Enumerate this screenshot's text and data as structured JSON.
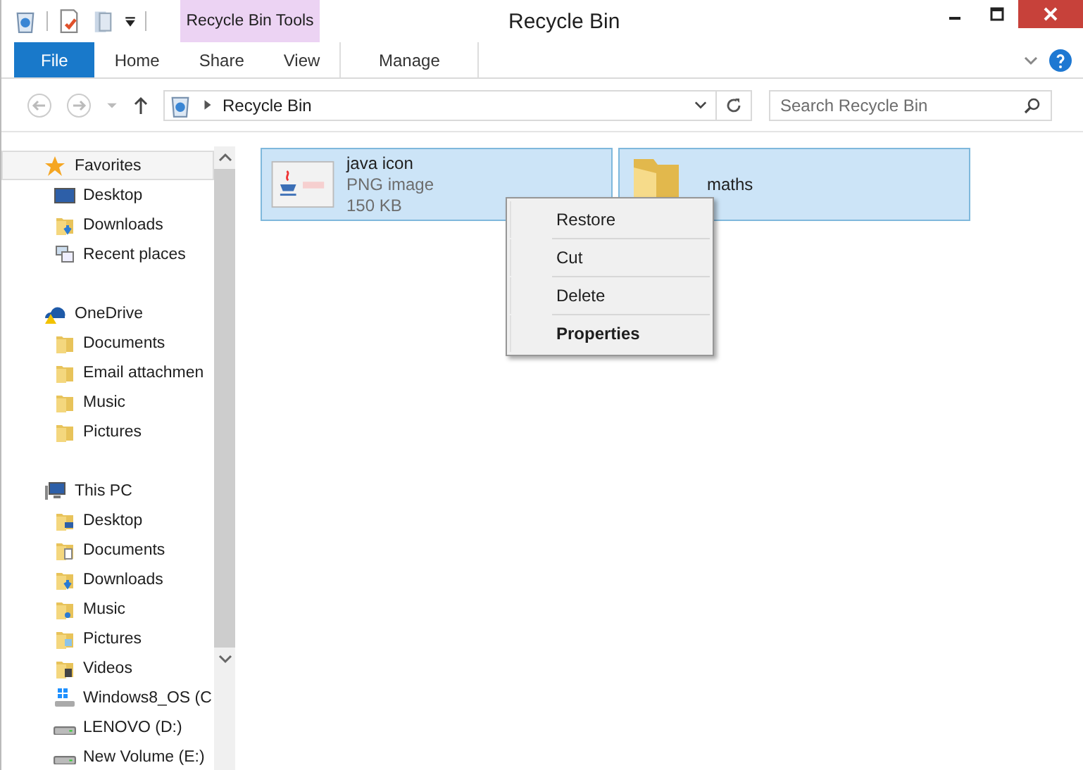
{
  "window": {
    "title": "Recycle Bin"
  },
  "contextual_tab_group": "Recycle Bin Tools",
  "ribbon_tabs": [
    {
      "label": "File",
      "kind": "file",
      "selected": false
    },
    {
      "label": "Home",
      "kind": "tab",
      "selected": false
    },
    {
      "label": "Share",
      "kind": "tab",
      "selected": false
    },
    {
      "label": "View",
      "kind": "tab",
      "selected": false
    },
    {
      "label": "Manage",
      "kind": "contextual",
      "selected": false
    }
  ],
  "address_bar": {
    "path": "Recycle Bin"
  },
  "search": {
    "placeholder": "Search Recycle Bin"
  },
  "navigation": [
    {
      "label": "Favorites",
      "kind": "favorites",
      "selected": true,
      "children": [
        {
          "label": "Desktop",
          "kind": "desktop"
        },
        {
          "label": "Downloads",
          "kind": "downloads"
        },
        {
          "label": "Recent places",
          "kind": "recent"
        }
      ]
    },
    {
      "label": "OneDrive",
      "kind": "cloud",
      "selected": false,
      "children": [
        {
          "label": "Documents",
          "kind": "folder"
        },
        {
          "label": "Email attachmen",
          "kind": "folder"
        },
        {
          "label": "Music",
          "kind": "folder"
        },
        {
          "label": "Pictures",
          "kind": "folder"
        }
      ]
    },
    {
      "label": "This PC",
      "kind": "pc",
      "selected": false,
      "children": [
        {
          "label": "Desktop",
          "kind": "desktop-folder"
        },
        {
          "label": "Documents",
          "kind": "documents"
        },
        {
          "label": "Downloads",
          "kind": "downloads"
        },
        {
          "label": "Music",
          "kind": "music"
        },
        {
          "label": "Pictures",
          "kind": "pictures"
        },
        {
          "label": "Videos",
          "kind": "videos"
        },
        {
          "label": "Windows8_OS (C",
          "kind": "os-drive"
        },
        {
          "label": "LENOVO (D:)",
          "kind": "drive"
        },
        {
          "label": "New Volume (E:)",
          "kind": "drive"
        }
      ]
    }
  ],
  "files": [
    {
      "name": "java icon",
      "type": "PNG image",
      "size": "150 KB",
      "selected": true
    },
    {
      "name": "maths",
      "kind": "folder",
      "selected": true
    }
  ],
  "context_menu": [
    {
      "label": "Restore",
      "default": false
    },
    {
      "label": "Cut",
      "default": false
    },
    {
      "label": "Delete",
      "default": false
    },
    {
      "label": "Properties",
      "default": true
    }
  ]
}
